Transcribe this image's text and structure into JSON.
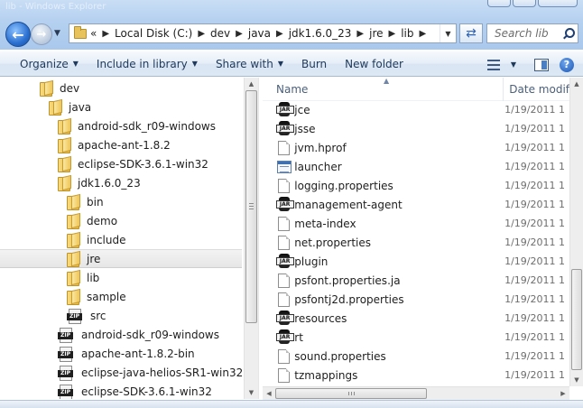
{
  "window": {
    "title_ghost": "lib - Windows Explorer"
  },
  "address": {
    "overflow_chevron": "«",
    "crumbs": [
      "Local Disk (C:)",
      "dev",
      "java",
      "jdk1.6.0_23",
      "jre",
      "lib"
    ]
  },
  "search": {
    "placeholder": "Search lib"
  },
  "toolbar": {
    "organize": "Organize",
    "include_in_library": "Include in library",
    "share_with": "Share with",
    "burn": "Burn",
    "new_folder": "New folder"
  },
  "nav_tree": [
    {
      "label": "dev",
      "icon": "folder-icon",
      "indent": 0
    },
    {
      "label": "java",
      "icon": "folder-icon",
      "indent": 1
    },
    {
      "label": "android-sdk_r09-windows",
      "icon": "folder-icon",
      "indent": 2
    },
    {
      "label": "apache-ant-1.8.2",
      "icon": "folder-icon",
      "indent": 2
    },
    {
      "label": "eclipse-SDK-3.6.1-win32",
      "icon": "folder-icon",
      "indent": 2
    },
    {
      "label": "jdk1.6.0_23",
      "icon": "folder-icon",
      "indent": 2
    },
    {
      "label": "bin",
      "icon": "folder-icon",
      "indent": 3
    },
    {
      "label": "demo",
      "icon": "folder-icon",
      "indent": 3
    },
    {
      "label": "include",
      "icon": "folder-icon",
      "indent": 3
    },
    {
      "label": "jre",
      "icon": "folder-icon",
      "indent": 3,
      "selected": true
    },
    {
      "label": "lib",
      "icon": "folder-icon",
      "indent": 3
    },
    {
      "label": "sample",
      "icon": "folder-icon",
      "indent": 3
    },
    {
      "label": "src",
      "icon": "zip-icon",
      "indent": 3
    },
    {
      "label": "android-sdk_r09-windows",
      "icon": "zip-icon",
      "indent": 2
    },
    {
      "label": "apache-ant-1.8.2-bin",
      "icon": "zip-icon",
      "indent": 2
    },
    {
      "label": "eclipse-java-helios-SR1-win32",
      "icon": "zip-icon",
      "indent": 2
    },
    {
      "label": "eclipse-SDK-3.6.1-win32",
      "icon": "zip-icon",
      "indent": 2
    }
  ],
  "columns": {
    "name": "Name",
    "date": "Date modif"
  },
  "files": [
    {
      "name": "jce",
      "icon": "jar-icon",
      "date": "1/19/2011 1"
    },
    {
      "name": "jsse",
      "icon": "jar-icon",
      "date": "1/19/2011 1"
    },
    {
      "name": "jvm.hprof",
      "icon": "doc-icon",
      "date": "1/19/2011 1"
    },
    {
      "name": "launcher",
      "icon": "exe-icon",
      "date": "1/19/2011 1"
    },
    {
      "name": "logging.properties",
      "icon": "doc-icon",
      "date": "1/19/2011 1"
    },
    {
      "name": "management-agent",
      "icon": "jar-icon",
      "date": "1/19/2011 1"
    },
    {
      "name": "meta-index",
      "icon": "doc-icon",
      "date": "1/19/2011 1"
    },
    {
      "name": "net.properties",
      "icon": "doc-icon",
      "date": "1/19/2011 1"
    },
    {
      "name": "plugin",
      "icon": "jar-icon",
      "date": "1/19/2011 1"
    },
    {
      "name": "psfont.properties.ja",
      "icon": "doc-icon",
      "date": "1/19/2011 1"
    },
    {
      "name": "psfontj2d.properties",
      "icon": "doc-icon",
      "date": "1/19/2011 1"
    },
    {
      "name": "resources",
      "icon": "jar-icon",
      "date": "1/19/2011 1"
    },
    {
      "name": "rt",
      "icon": "jar-icon",
      "date": "1/19/2011 1"
    },
    {
      "name": "sound.properties",
      "icon": "doc-icon",
      "date": "1/19/2011 1"
    },
    {
      "name": "tzmappings",
      "icon": "doc-icon",
      "date": "1/19/2011 1"
    }
  ],
  "colors": {
    "chrome": "#b6d1f0",
    "command_text": "#1e395b",
    "selection": "#e6e6e6"
  }
}
